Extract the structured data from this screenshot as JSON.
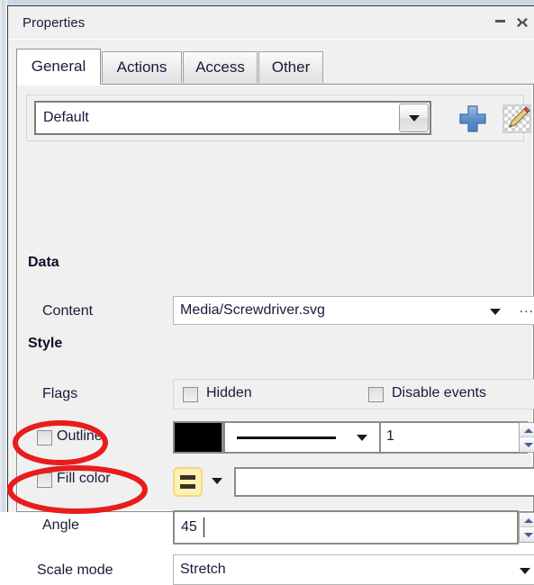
{
  "window": {
    "title": "Properties",
    "minimize_label": "–",
    "close_label": "✕"
  },
  "tabs": [
    {
      "label": "General",
      "selected": true
    },
    {
      "label": "Actions",
      "selected": false
    },
    {
      "label": "Access",
      "selected": false
    },
    {
      "label": "Other",
      "selected": false
    }
  ],
  "preset": {
    "value": "Default",
    "dropdown_icon": "chevron-down-icon",
    "add_icon": "plus-icon",
    "edit_icon": "pencil-edit-icon"
  },
  "sections": {
    "data": "Data",
    "style": "Style"
  },
  "rows": {
    "content": {
      "label": "Content",
      "value": "Media/Screwdriver.svg",
      "dropdown_icon": "chevron-down-icon",
      "browse_label": "..."
    },
    "flags": {
      "label": "Flags",
      "items": [
        {
          "label": "Hidden",
          "checked": false
        },
        {
          "label": "Disable events",
          "checked": false
        }
      ]
    },
    "outline": {
      "label": "Outline",
      "checked": false,
      "color": "#000000",
      "line_style_icon": "solid-line-icon",
      "width": "1"
    },
    "fill_color": {
      "label": "Fill color",
      "checked": false,
      "swatch_icon": "gradient-bars-icon",
      "swatch_color": "#fff0b3",
      "value": ""
    },
    "angle": {
      "label": "Angle",
      "value": "45"
    },
    "scale_mode": {
      "label": "Scale mode",
      "value": "Stretch",
      "dropdown_icon": "chevron-down-icon"
    }
  },
  "annotations": {
    "color": "#e81c1c",
    "shapes": [
      {
        "name": "angle-highlight-ellipse",
        "target": "Angle"
      },
      {
        "name": "scale-mode-highlight-ellipse",
        "target": "Scale mode"
      }
    ]
  }
}
